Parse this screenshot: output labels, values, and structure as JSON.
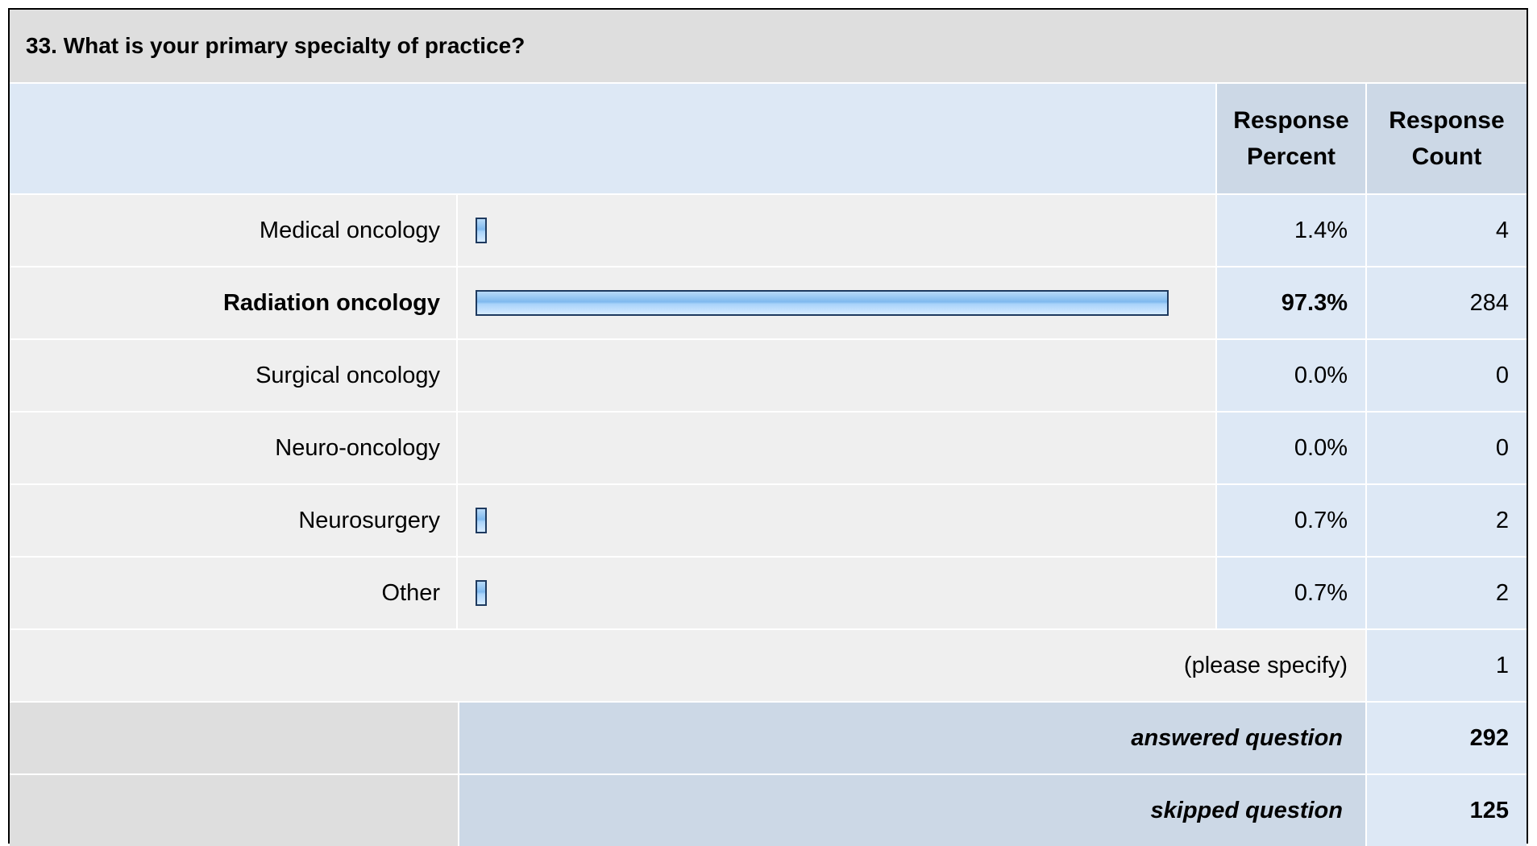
{
  "question_title": "33. What is your primary specialty of practice?",
  "header": {
    "percent_label": "Response Percent",
    "count_label": "Response Count"
  },
  "chart_data": {
    "type": "bar",
    "orientation": "horizontal",
    "categories": [
      "Medical oncology",
      "Radiation oncology",
      "Surgical oncology",
      "Neuro-oncology",
      "Neurosurgery",
      "Other"
    ],
    "percent_labels": [
      "1.4%",
      "97.3%",
      "0.0%",
      "0.0%",
      "0.7%",
      "0.7%"
    ],
    "values": [
      1.4,
      97.3,
      0.0,
      0.0,
      0.7,
      0.7
    ],
    "counts": [
      "4",
      "284",
      "0",
      "0",
      "2",
      "2"
    ],
    "highlight_index": 1,
    "xlim": [
      0,
      100
    ],
    "bar_color": "#7fb9ee",
    "bar_border_color": "#1e3a5f"
  },
  "other_specify": {
    "label": "(please specify)",
    "count": "1"
  },
  "summary": {
    "answered_label": "answered question",
    "answered_value": "292",
    "skipped_label": "skipped question",
    "skipped_value": "125"
  }
}
